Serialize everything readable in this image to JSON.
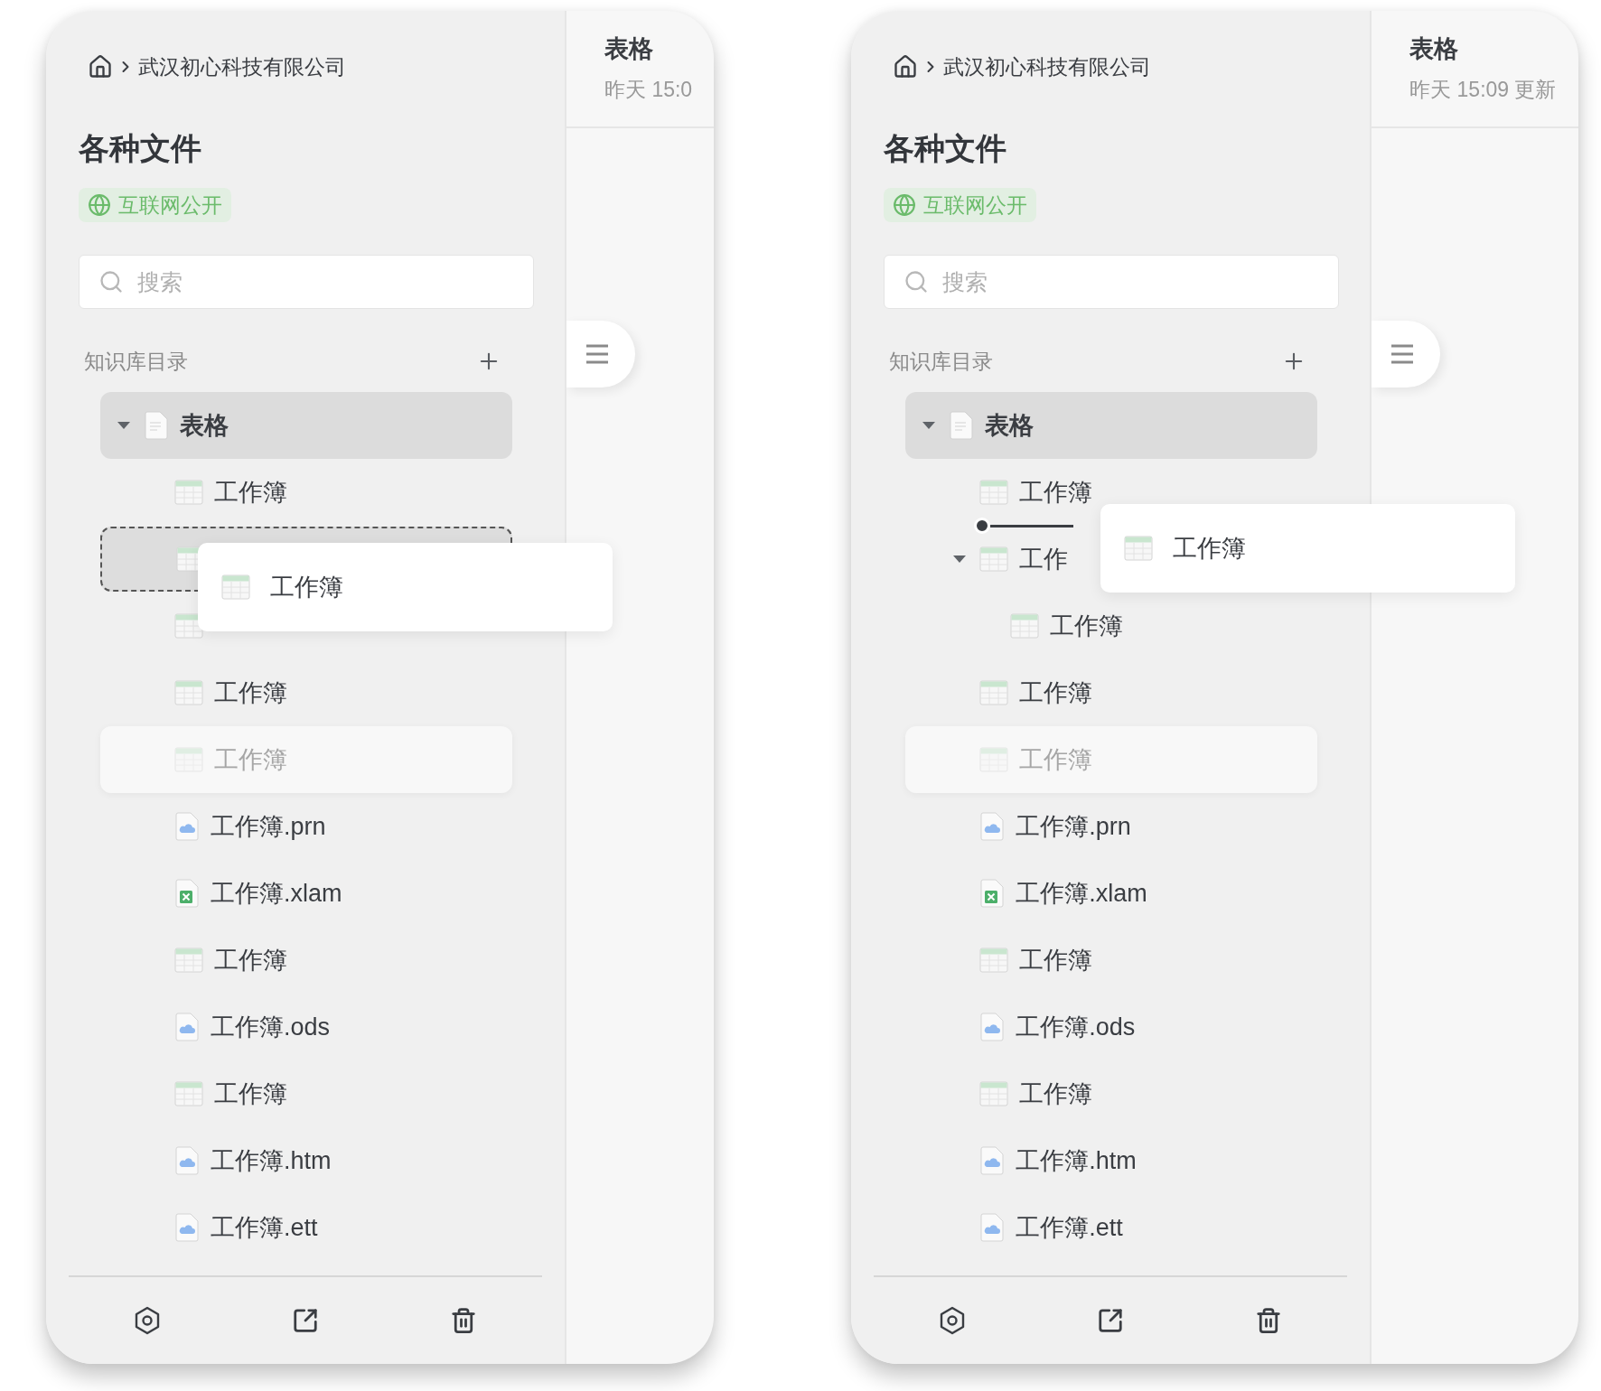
{
  "panels": [
    {
      "breadcrumb": {
        "company": "武汉初心科技有限公司"
      },
      "title": "各种文件",
      "badge": "互联网公开",
      "search": {
        "placeholder": "搜索"
      },
      "section": {
        "label": "知识库目录"
      },
      "tree": [
        {
          "kind": "doc",
          "label": "表格",
          "selected": true,
          "dimmed": false,
          "expanded": true,
          "children": [
            {
              "kind": "sheet",
              "label": "工作簿",
              "selected": false,
              "dimmed": false
            },
            {
              "kind": "placeholder"
            },
            {
              "kind": "covered"
            },
            {
              "kind": "sheet",
              "label": "工作簿",
              "selected": false,
              "dimmed": false
            },
            {
              "kind": "sheet",
              "label": "工作簿",
              "selected": false,
              "dimmed": true
            },
            {
              "kind": "cloud",
              "label": "工作簿.prn",
              "selected": false,
              "dimmed": false
            },
            {
              "kind": "excel",
              "label": "工作簿.xlam",
              "selected": false,
              "dimmed": false
            },
            {
              "kind": "sheet",
              "label": "工作簿",
              "selected": false,
              "dimmed": false
            },
            {
              "kind": "cloud",
              "label": "工作簿.ods",
              "selected": false,
              "dimmed": false
            },
            {
              "kind": "sheet",
              "label": "工作簿",
              "selected": false,
              "dimmed": false
            },
            {
              "kind": "cloud",
              "label": "工作簿.htm",
              "selected": false,
              "dimmed": false
            },
            {
              "kind": "cloud",
              "label": "工作簿.ett",
              "selected": false,
              "dimmed": false
            }
          ]
        }
      ],
      "drag_ghost": {
        "label": "工作簿"
      },
      "pane": {
        "title": "表格",
        "subtitle": "昨天 15:0"
      }
    },
    {
      "breadcrumb": {
        "company": "武汉初心科技有限公司"
      },
      "title": "各种文件",
      "badge": "互联网公开",
      "search": {
        "placeholder": "搜索"
      },
      "section": {
        "label": "知识库目录"
      },
      "tree": [
        {
          "kind": "doc",
          "label": "表格",
          "selected": true,
          "dimmed": false,
          "expanded": true,
          "children": [
            {
              "kind": "sheet",
              "label": "工作簿",
              "selected": false,
              "dimmed": false
            },
            {
              "kind": "drop-line"
            },
            {
              "kind": "sheet",
              "label": "工作",
              "selected": false,
              "dimmed": false,
              "expanded": true,
              "children": [
                {
                  "kind": "sheet",
                  "label": "工作簿",
                  "selected": false,
                  "dimmed": false
                }
              ]
            },
            {
              "kind": "sheet",
              "label": "工作簿",
              "selected": false,
              "dimmed": false
            },
            {
              "kind": "sheet",
              "label": "工作簿",
              "selected": false,
              "dimmed": true
            },
            {
              "kind": "cloud",
              "label": "工作簿.prn",
              "selected": false,
              "dimmed": false
            },
            {
              "kind": "excel",
              "label": "工作簿.xlam",
              "selected": false,
              "dimmed": false
            },
            {
              "kind": "sheet",
              "label": "工作簿",
              "selected": false,
              "dimmed": false
            },
            {
              "kind": "cloud",
              "label": "工作簿.ods",
              "selected": false,
              "dimmed": false
            },
            {
              "kind": "sheet",
              "label": "工作簿",
              "selected": false,
              "dimmed": false
            },
            {
              "kind": "cloud",
              "label": "工作簿.htm",
              "selected": false,
              "dimmed": false
            },
            {
              "kind": "cloud",
              "label": "工作簿.ett",
              "selected": false,
              "dimmed": false
            }
          ]
        }
      ],
      "drag_ghost": {
        "label": "工作簿"
      },
      "pane": {
        "title": "表格",
        "subtitle": "昨天 15:09 更新"
      }
    }
  ]
}
